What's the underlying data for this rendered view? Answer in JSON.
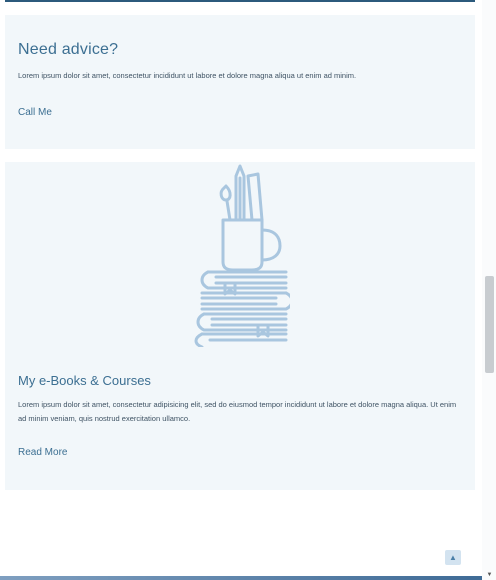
{
  "advice": {
    "title": "Need advice?",
    "text": "Lorem ipsum dolor sit amet, consectetur incididunt ut labore et dolore magna aliqua ut enim ad minim.",
    "link_label": "Call Me"
  },
  "ebooks": {
    "illustration_icon": "books-and-pencil-cup-icon",
    "title": "My e-Books & Courses",
    "text": "Lorem ipsum dolor sit amet, consectetur adipisicing elit, sed do eiusmod tempor incididunt ut labore et dolore magna aliqua. Ut enim ad minim veniam, quis nostrud exercitation ullamco.",
    "link_label": "Read More"
  },
  "back_to_top": {
    "icon": "chevron-up-icon",
    "glyph": "▲"
  },
  "scrollbar": {
    "down_glyph": "▼"
  },
  "colors": {
    "accent": "#3c6f92",
    "card_bg": "#f2f7fa",
    "illustration": "#a9c6df",
    "top_rule": "#2c5a7c"
  }
}
